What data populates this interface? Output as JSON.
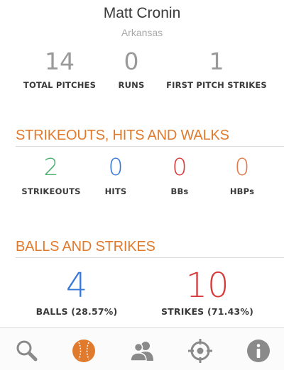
{
  "player": {
    "name": "Matt Cronin",
    "team": "Arkansas"
  },
  "top_stats": [
    {
      "value": "14",
      "label": "TOTAL PITCHES"
    },
    {
      "value": "0",
      "label": "RUNS"
    },
    {
      "value": "1",
      "label": "FIRST PITCH STRIKES"
    }
  ],
  "skw_section": {
    "title": "STRIKEOUTS, HITS AND WALKS",
    "stats": [
      {
        "value": "2",
        "label": "STRIKEOUTS",
        "color": "#4cae6e"
      },
      {
        "value": "0",
        "label": "HITS",
        "color": "#3a78d8"
      },
      {
        "value": "0",
        "label": "BBs",
        "color": "#d83a3a"
      },
      {
        "value": "0",
        "label": "HBPs",
        "color": "#e07b4e"
      }
    ]
  },
  "bs_section": {
    "title": "BALLS AND STRIKES",
    "stats": [
      {
        "value": "4",
        "label": "BALLS (28.57%)",
        "color": "#3a78d8"
      },
      {
        "value": "10",
        "label": "STRIKES (71.43%)",
        "color": "#d83a3a"
      }
    ]
  },
  "tabs": [
    {
      "icon": "search-icon",
      "active": false
    },
    {
      "icon": "baseball-icon",
      "active": true
    },
    {
      "icon": "players-icon",
      "active": false
    },
    {
      "icon": "crosshair-icon",
      "active": false
    },
    {
      "icon": "info-icon",
      "active": false
    }
  ],
  "colors": {
    "accent": "#e07b2e",
    "inactive_icon": "#8a8a8a"
  }
}
